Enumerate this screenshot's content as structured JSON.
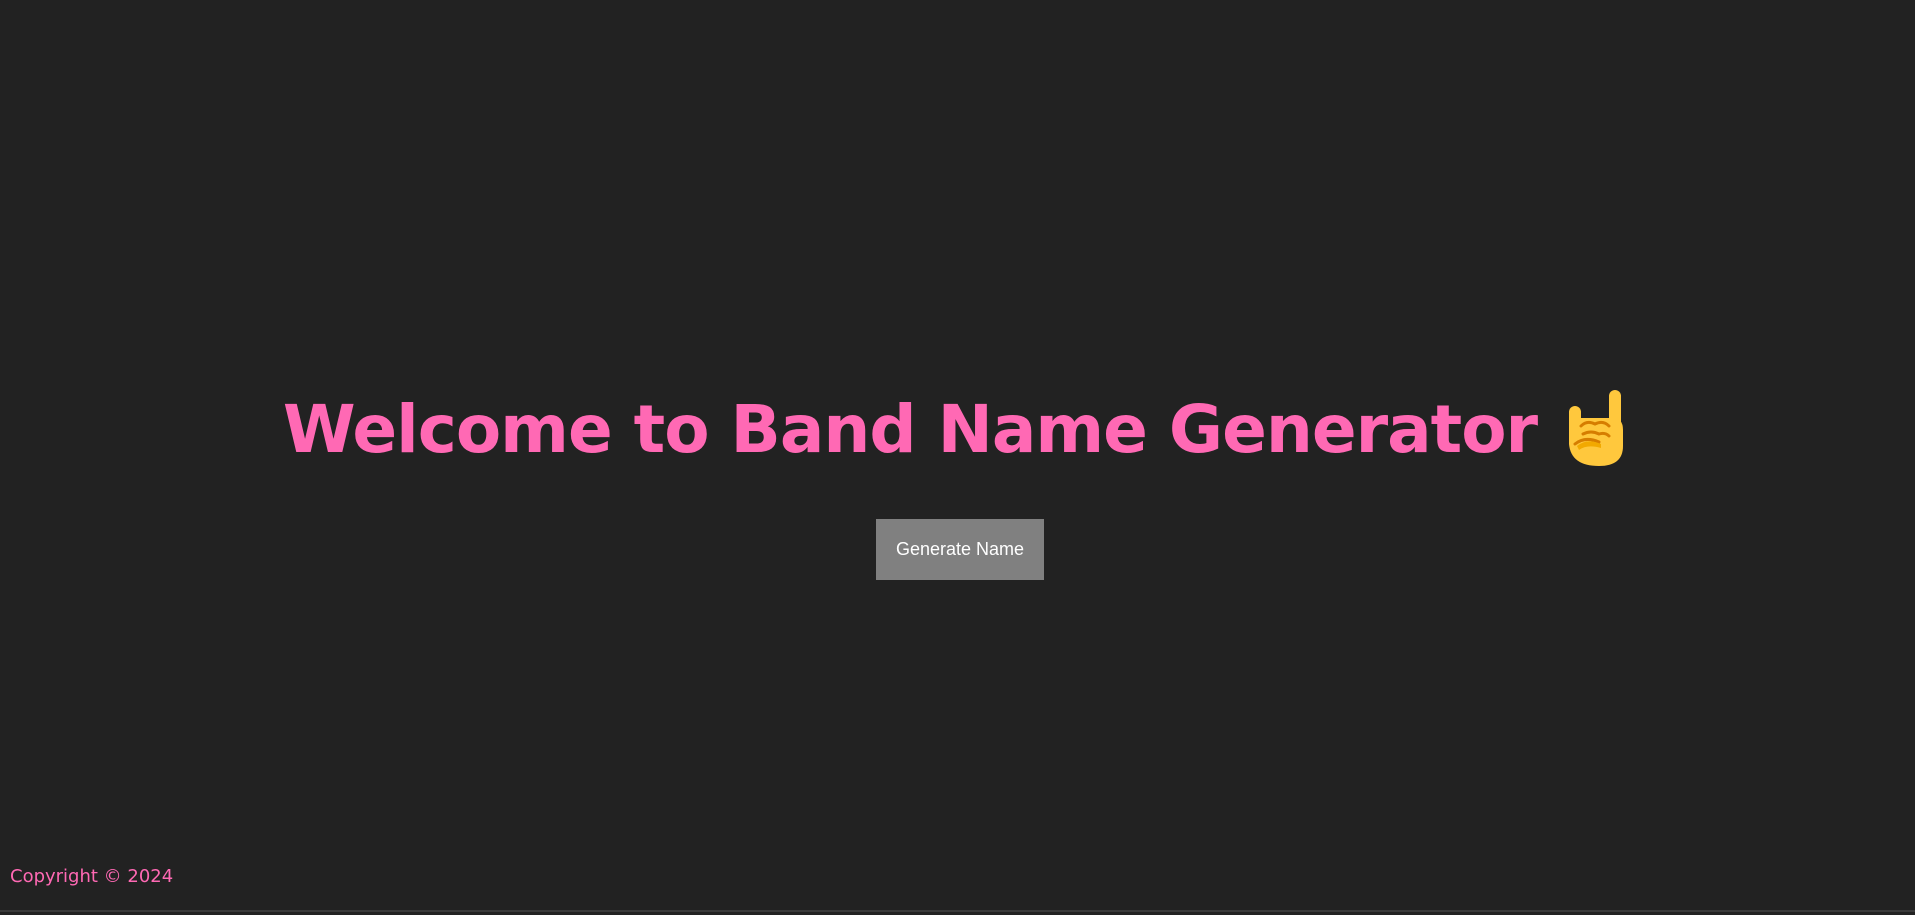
{
  "header": {
    "title": "Welcome to Band Name Generator",
    "title_icon": "rock-on-hand-emoji"
  },
  "main": {
    "generate_label": "Generate Name"
  },
  "footer": {
    "copyright": "Copyright © 2024"
  },
  "colors": {
    "background": "#222222",
    "accent": "#ff69b4",
    "button_bg": "#808080",
    "button_text": "#ffffff",
    "emoji_yellow": "#ffc83d",
    "emoji_shade": "#d67d00"
  }
}
